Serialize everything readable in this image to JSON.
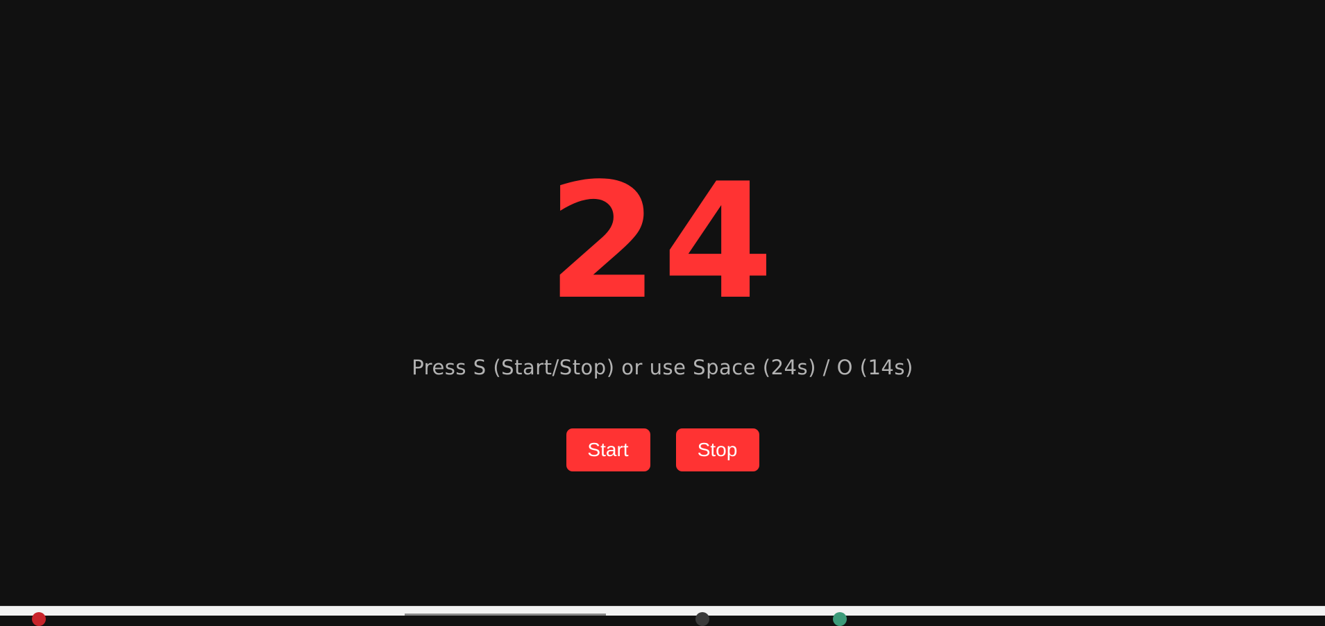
{
  "timer": {
    "value": "24",
    "color": "#ff3333"
  },
  "instructions": {
    "text": "Press S (Start/Stop) or use Space (24s) / O (14s)"
  },
  "controls": {
    "start_label": "Start",
    "stop_label": "Stop",
    "accent_color": "#ff3333"
  },
  "theme": {
    "background": "#111111",
    "instruction_color": "#b3b3b3"
  },
  "taskbar": {
    "icons": [
      "app-red-icon",
      "app-dark-icon",
      "app-green-icon"
    ]
  }
}
